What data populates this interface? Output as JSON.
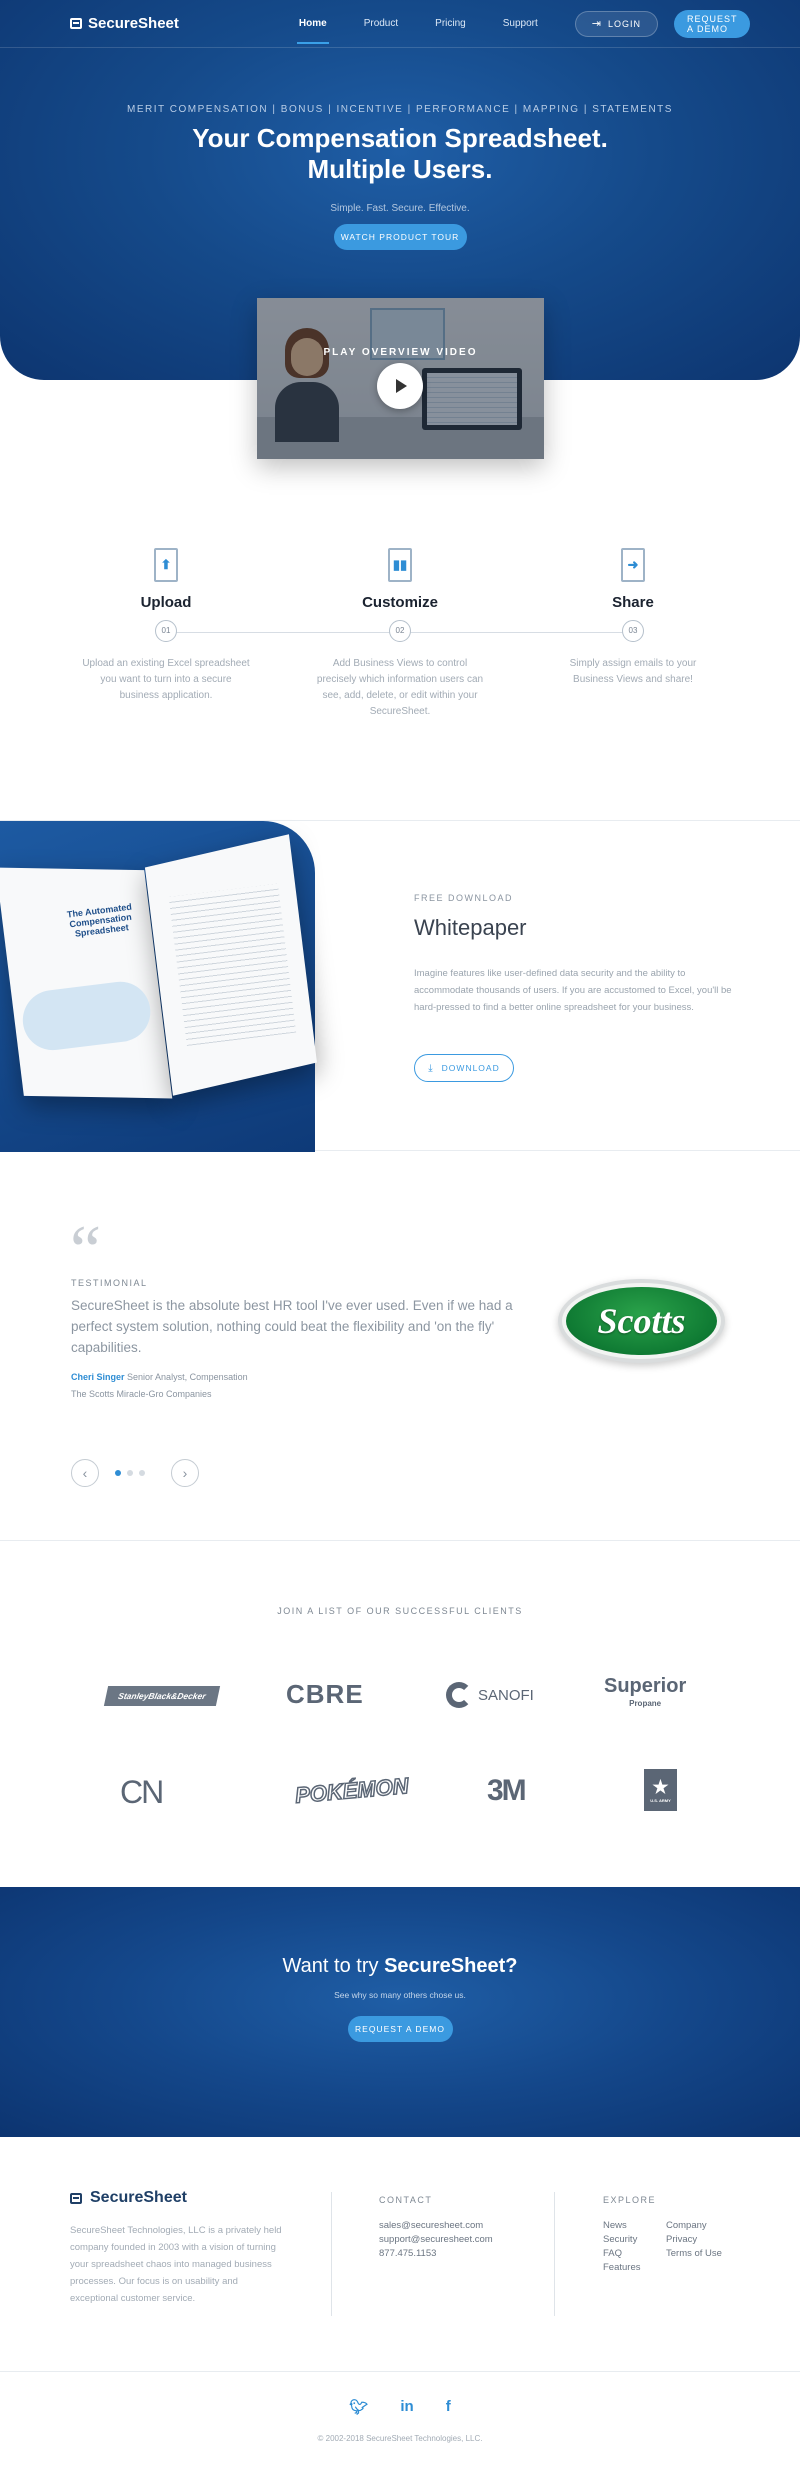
{
  "nav": {
    "brand": "SecureSheet",
    "links": [
      "Home",
      "Product",
      "Pricing",
      "Support"
    ],
    "login": "LOGIN",
    "demo": "REQUEST A DEMO"
  },
  "hero": {
    "tags": "MERIT COMPENSATION | BONUS | INCENTIVE | PERFORMANCE | MAPPING | STATEMENTS",
    "title_line1": "Your Compensation Spreadsheet.",
    "title_line2": "Multiple Users.",
    "subtitle": "Simple. Fast. Secure. Effective.",
    "tour_button": "WATCH PRODUCT TOUR",
    "video_label": "PLAY OVERVIEW VIDEO"
  },
  "steps": [
    {
      "title": "Upload",
      "num": "01",
      "desc": "Upload an existing Excel spreadsheet you want to turn into a secure business application.",
      "icon": "upload-file-icon"
    },
    {
      "title": "Customize",
      "num": "02",
      "desc": "Add Business Views to control precisely which information users can see, add, delete, or edit within your SecureSheet.",
      "icon": "chart-file-icon"
    },
    {
      "title": "Share",
      "num": "03",
      "desc": "Simply assign emails to your Business Views and share!",
      "icon": "share-file-icon"
    }
  ],
  "whitepaper": {
    "eyebrow": "FREE DOWNLOAD",
    "title": "Whitepaper",
    "body": "Imagine features like user-defined data security and the ability to accommodate thousands of users. If you are accustomed to Excel, you'll be hard-pressed to find a better online spreadsheet for your business.",
    "button": "DOWNLOAD",
    "book_title": "The Automated Compensation Spreadsheet"
  },
  "testimonial": {
    "label": "TESTIMONIAL",
    "quote": "SecureSheet is the absolute best HR tool I've ever used. Even if we had a perfect system solution, nothing could beat the flexibility and 'on the fly' capabilities.",
    "name": "Cheri Singer",
    "role": "Senior Analyst, Compensation",
    "company": "The Scotts Miracle-Gro Companies",
    "logo_text": "Scotts",
    "active_slide": 1,
    "slide_count": 3
  },
  "clients": {
    "title": "JOIN A LIST OF OUR SUCCESSFUL CLIENTS",
    "logos": [
      "StanleyBlack&Decker",
      "CBRE",
      "SANOFI",
      "Superior",
      "Propane",
      "CN",
      "POKÉMON",
      "3M",
      "★",
      "U.S. ARMY"
    ]
  },
  "cta": {
    "title_plain": "Want to try",
    "title_bold": "SecureSheet?",
    "subtitle": "See why so many others chose us.",
    "button": "REQUEST A DEMO"
  },
  "footer": {
    "brand": "SecureSheet",
    "about": "SecureSheet Technologies, LLC is a privately held company founded in 2003 with a vision of turning your spreadsheet chaos into managed business processes. Our focus is on usability and exceptional customer service.",
    "contact_title": "CONTACT",
    "contact": [
      "sales@securesheet.com",
      "support@securesheet.com",
      "877.475.1153"
    ],
    "explore_title": "EXPLORE",
    "explore_col1": [
      "News",
      "Security",
      "FAQ",
      "Features"
    ],
    "explore_col2": [
      "Company",
      "Privacy",
      "Terms of Use"
    ],
    "social": [
      "twitter-icon",
      "linkedin-icon",
      "facebook-icon"
    ],
    "copyright": "© 2002-2018 SecureSheet Technologies, LLC."
  },
  "colors": {
    "primary": "#3b9ae0",
    "hero_dark": "#0d3570",
    "hero_light": "#1f5ea6"
  }
}
